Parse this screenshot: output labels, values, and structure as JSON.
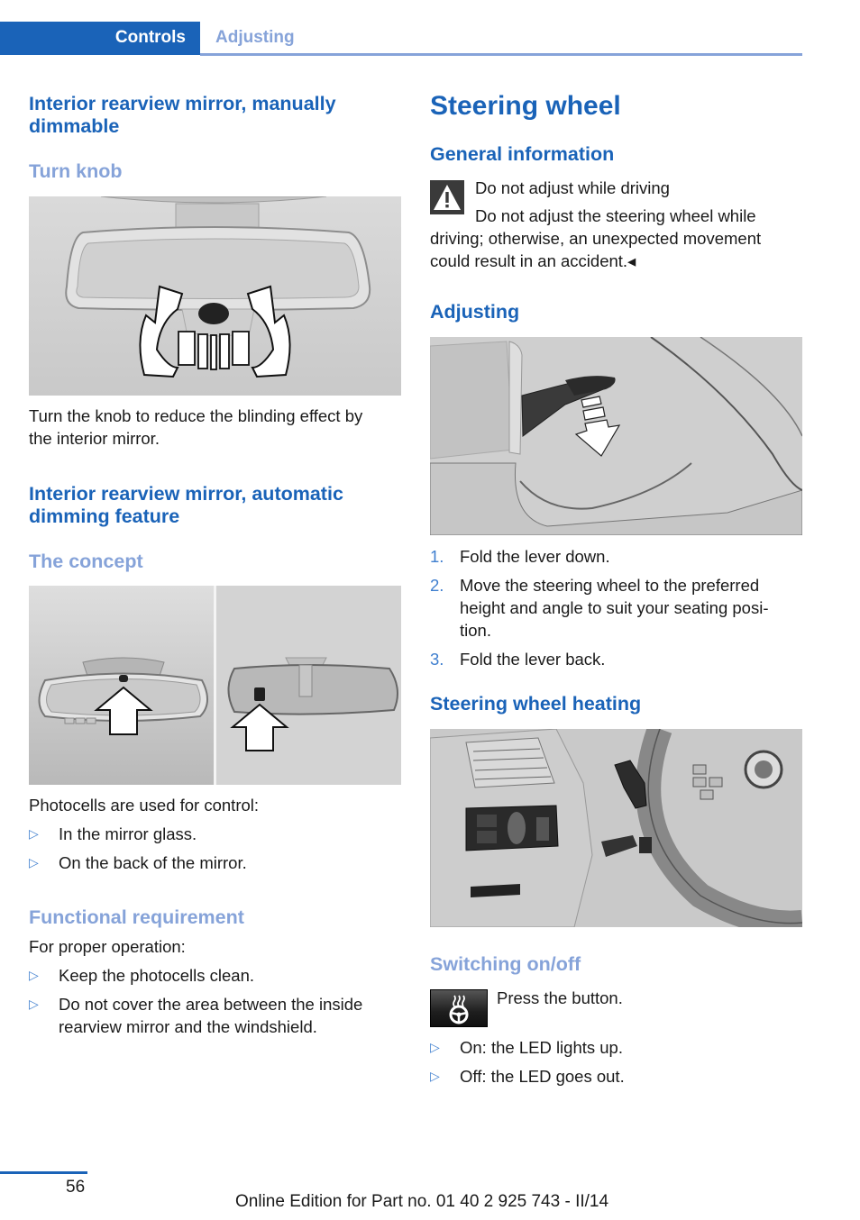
{
  "header": {
    "chapter_tab": "Controls",
    "breadcrumb": "Adjusting"
  },
  "left_column": {
    "section1": {
      "title": "Interior rearview mirror, manually dimmable",
      "title_line1": "Interior rearview mirror, manually",
      "title_line2": "dimmable",
      "subheading": "Turn knob",
      "figure_alt": "Rearview mirror with turn knob and rotation arrows",
      "body_line1": "Turn the knob to reduce the blinding effect by",
      "body_line2": "the interior mirror."
    },
    "section2": {
      "title_line1": "Interior rearview mirror, automatic",
      "title_line2": "dimming feature",
      "subheading": "The concept",
      "figure_alt": "Photocells in mirror glass and on back of mirror",
      "intro": "Photocells are used for control:",
      "bullets": [
        "In the mirror glass.",
        "On the back of the mirror."
      ],
      "req_heading": "Functional requirement",
      "req_intro": "For proper operation:",
      "req_bullets": [
        "Keep the photocells clean.",
        "Do not cover the area between the inside",
        "rearview mirror and the windshield."
      ]
    }
  },
  "right_column": {
    "title": "Steering wheel",
    "general": {
      "heading": "General information",
      "warning_title": "Do not adjust while driving",
      "warning_line1": "Do not adjust the steering wheel while",
      "warning_line2": "driving; otherwise, an unexpected movement",
      "warning_line3": "could result in an accident.◂"
    },
    "adjusting": {
      "heading": "Adjusting",
      "figure_alt": "Steering column lever folding down",
      "steps": [
        {
          "num": "1.",
          "text": "Fold the lever down."
        },
        {
          "num": "2.",
          "line1": "Move the steering wheel to the preferred",
          "line2": "height and angle to suit your seating posi-",
          "line3": "tion."
        },
        {
          "num": "3.",
          "text": "Fold the lever back."
        }
      ]
    },
    "heating": {
      "heading": "Steering wheel heating",
      "figure_alt": "Dashboard with steering wheel heating button",
      "switch_heading": "Switching on/off",
      "press_text": "Press the button.",
      "bullets": [
        "On: the LED lights up.",
        "Off: the LED goes out."
      ]
    }
  },
  "markers": {
    "bullet": "▷"
  },
  "footer": {
    "page_number": "56",
    "edition": "Online Edition for Part no. 01 40 2 925 743 - II/14"
  },
  "colors": {
    "primary_blue": "#1a63b8",
    "light_blue": "#86a3d9"
  }
}
